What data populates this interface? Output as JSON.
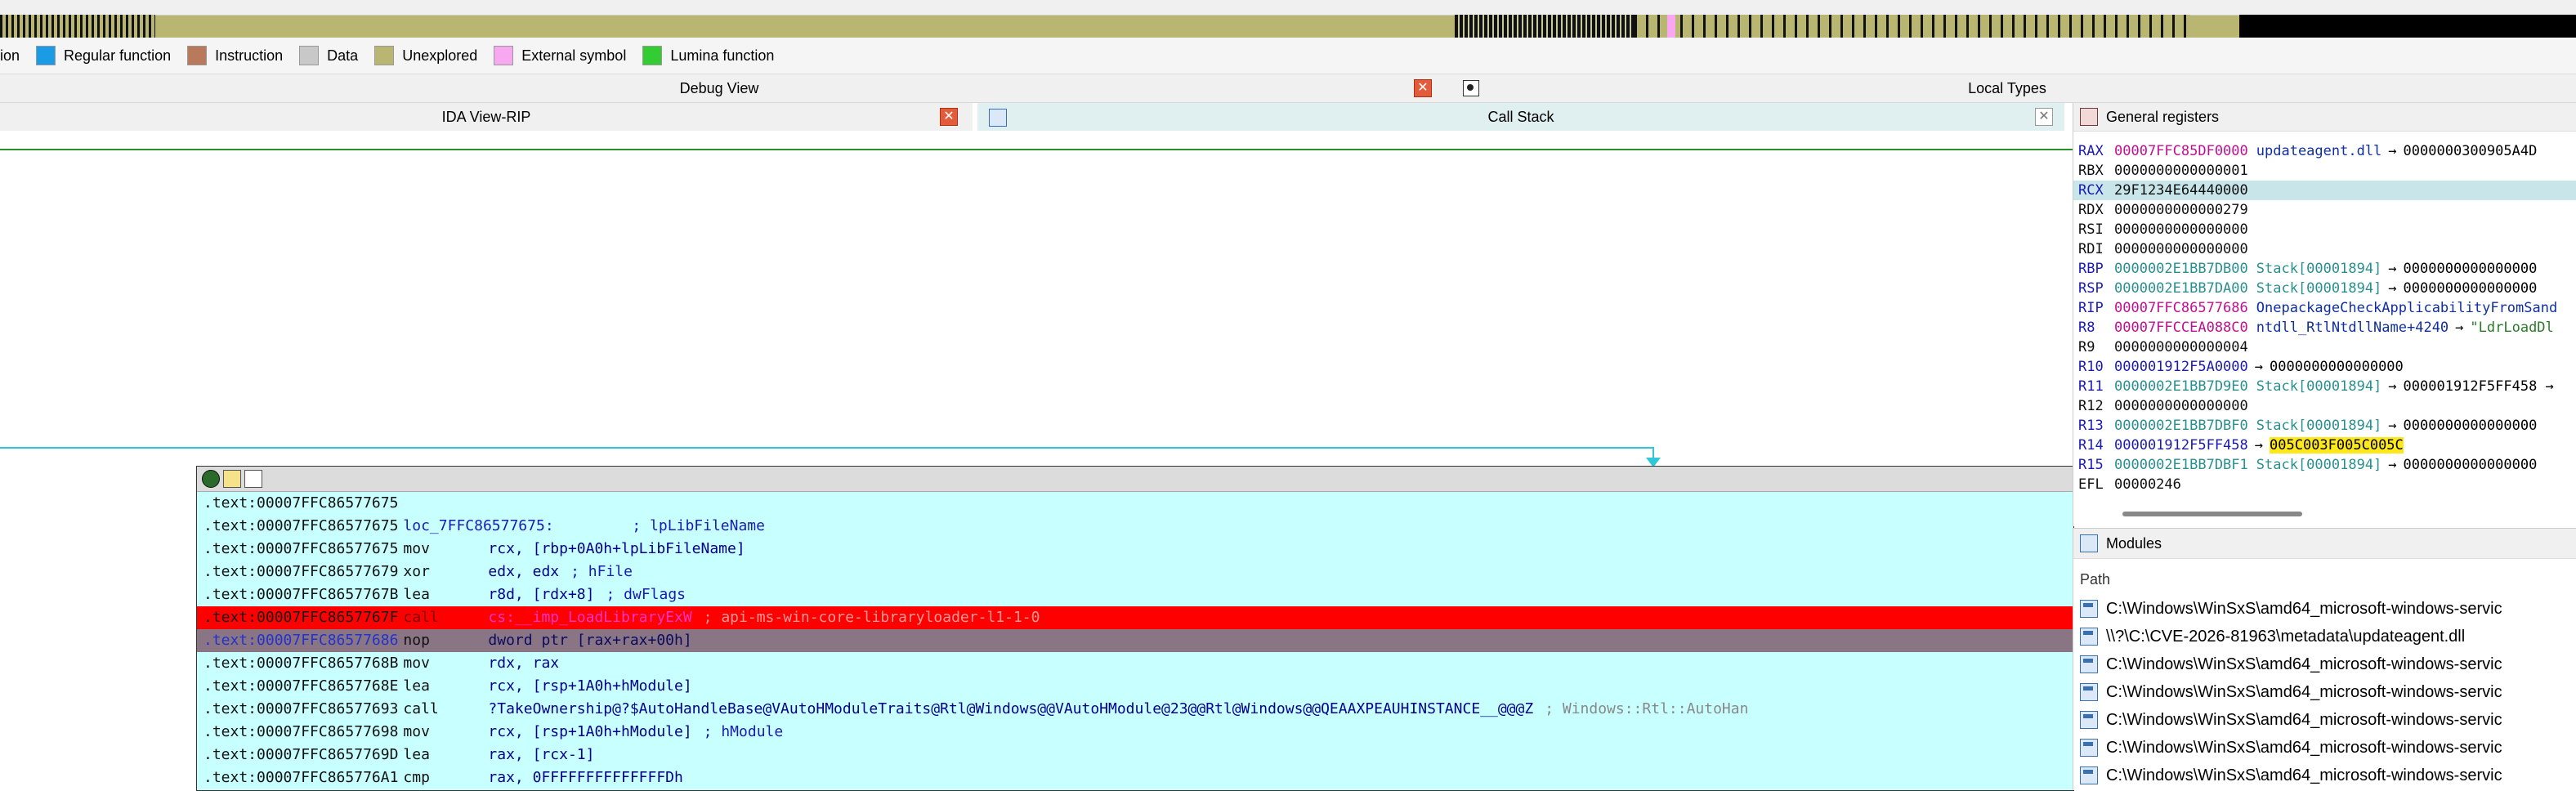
{
  "legend": [
    {
      "label": "ion",
      "color": ""
    },
    {
      "label": "Regular function",
      "color": "#1a9be6"
    },
    {
      "label": "Instruction",
      "color": "#b87a5a"
    },
    {
      "label": "Data",
      "color": "#c8c8c8"
    },
    {
      "label": "Unexplored",
      "color": "#b9b671"
    },
    {
      "label": "External symbol",
      "color": "#f7a8f0"
    },
    {
      "label": "Lumina function",
      "color": "#33cc33"
    }
  ],
  "debug_view": {
    "title": "Debug View"
  },
  "ida_view": {
    "title": "IDA View-RIP"
  },
  "call_stack": {
    "title": "Call Stack"
  },
  "local_types": {
    "title": "Local Types"
  },
  "registers": {
    "title": "General registers",
    "rows": [
      {
        "name": "RAX",
        "value": "00007FFC85DF0000",
        "ref": "updateagent.dll",
        "target": "0000000300905A4D",
        "arrow": "→",
        "highlight": false
      },
      {
        "name": "RBX",
        "value": "0000000000000001",
        "ref": "",
        "target": "",
        "arrow": "",
        "highlight": false
      },
      {
        "name": "RCX",
        "value": "29F1234E64440000",
        "ref": "",
        "target": "",
        "arrow": "",
        "highlight": true
      },
      {
        "name": "RDX",
        "value": "0000000000000279",
        "ref": "",
        "target": "",
        "arrow": "",
        "highlight": false
      },
      {
        "name": "RSI",
        "value": "0000000000000000",
        "ref": "",
        "target": "",
        "arrow": "",
        "highlight": false
      },
      {
        "name": "RDI",
        "value": "0000000000000000",
        "ref": "",
        "target": "",
        "arrow": "",
        "highlight": false
      },
      {
        "name": "RBP",
        "value": "0000002E1BB7DB00",
        "ref": "Stack[00001894]",
        "target": "0000000000000000",
        "arrow": "→",
        "highlight": false
      },
      {
        "name": "RSP",
        "value": "0000002E1BB7DA00",
        "ref": "Stack[00001894]",
        "target": "0000000000000000",
        "arrow": "→",
        "highlight": false
      },
      {
        "name": "RIP",
        "value": "00007FFC86577686",
        "ref": "OnepackageCheckApplicabilityFromSand",
        "target": "",
        "arrow": "",
        "highlight": false
      },
      {
        "name": "R8",
        "value": "00007FFCCEA088C0",
        "ref": "ntdll_RtlNtdllName+4240",
        "target": "\"LdrLoadDl",
        "arrow": "→",
        "highlight": false
      },
      {
        "name": "R9",
        "value": "0000000000000004",
        "ref": "",
        "target": "",
        "arrow": "",
        "highlight": false
      },
      {
        "name": "R10",
        "value": "000001912F5A0000",
        "ref": "",
        "target": "0000000000000000",
        "arrow": "→",
        "highlight": false
      },
      {
        "name": "R11",
        "value": "0000002E1BB7D9E0",
        "ref": "Stack[00001894]",
        "target": "000001912F5FF458 →",
        "arrow": "→",
        "highlight": false
      },
      {
        "name": "R12",
        "value": "0000000000000000",
        "ref": "",
        "target": "",
        "arrow": "",
        "highlight": false
      },
      {
        "name": "R13",
        "value": "0000002E1BB7DBF0",
        "ref": "Stack[00001894]",
        "target": "0000000000000000",
        "arrow": "→",
        "highlight": false
      },
      {
        "name": "R14",
        "value": "000001912F5FF458",
        "ref": "",
        "target": "005C003F005C005C",
        "arrow": "→",
        "highlight": false
      },
      {
        "name": "R15",
        "value": "0000002E1BB7DBF1",
        "ref": "Stack[00001894]",
        "target": "0000000000000000",
        "arrow": "→",
        "highlight": false
      },
      {
        "name": "EFL",
        "value": "00000246",
        "ref": "",
        "target": "",
        "arrow": "",
        "highlight": false
      }
    ]
  },
  "modules": {
    "title": "Modules",
    "column": "Path",
    "rows": [
      "C:\\Windows\\WinSxS\\amd64_microsoft-windows-servic",
      "\\\\?\\C:\\CVE-2026-81963\\metadata\\updateagent.dll",
      "C:\\Windows\\WinSxS\\amd64_microsoft-windows-servic",
      "C:\\Windows\\WinSxS\\amd64_microsoft-windows-servic",
      "C:\\Windows\\WinSxS\\amd64_microsoft-windows-servic",
      "C:\\Windows\\WinSxS\\amd64_microsoft-windows-servic",
      "C:\\Windows\\WinSxS\\amd64_microsoft-windows-servic"
    ]
  },
  "disasm": [
    {
      "addr": ".text:00007FFC86577675",
      "mnem": "",
      "ops": "",
      "comment": "",
      "style": "normal"
    },
    {
      "addr": ".text:00007FFC86577675",
      "mnem": "loc_7FFC86577675:",
      "ops": "",
      "comment": "; lpLibFileName",
      "style": "label"
    },
    {
      "addr": ".text:00007FFC86577675",
      "mnem": "mov",
      "ops": "rcx, [rbp+0A0h+lpLibFileName]",
      "comment": "",
      "style": "normal"
    },
    {
      "addr": ".text:00007FFC86577679",
      "mnem": "xor",
      "ops": "edx, edx",
      "comment": "; hFile",
      "style": "normal"
    },
    {
      "addr": ".text:00007FFC8657767B",
      "mnem": "lea",
      "ops": "r8d, [rdx+8]",
      "comment": "; dwFlags",
      "style": "normal"
    },
    {
      "addr": ".text:00007FFC8657767F",
      "mnem": "call",
      "ops": "cs:__imp_LoadLibraryExW",
      "comment": "; api-ms-win-core-libraryloader-l1-1-0",
      "style": "breakpoint"
    },
    {
      "addr": ".text:00007FFC86577686",
      "mnem": "nop",
      "ops": "dword ptr [rax+rax+00h]",
      "comment": "",
      "style": "current"
    },
    {
      "addr": ".text:00007FFC8657768B",
      "mnem": "mov",
      "ops": "rdx, rax",
      "comment": "",
      "style": "normal"
    },
    {
      "addr": ".text:00007FFC8657768E",
      "mnem": "lea",
      "ops": "rcx, [rsp+1A0h+hModule]",
      "comment": "",
      "style": "normal"
    },
    {
      "addr": ".text:00007FFC86577693",
      "mnem": "call",
      "ops": "?TakeOwnership@?$AutoHandleBase@VAutoHModuleTraits@Rtl@Windows@@VAutoHModule@23@@Rtl@Windows@@QEAAXPEAUHINSTANCE__@@@Z",
      "comment": "; Windows::Rtl::AutoHan",
      "style": "normal"
    },
    {
      "addr": ".text:00007FFC86577698",
      "mnem": "mov",
      "ops": "rcx, [rsp+1A0h+hModule]",
      "comment": "; hModule",
      "style": "normal"
    },
    {
      "addr": ".text:00007FFC8657769D",
      "mnem": "lea",
      "ops": "rax, [rcx-1]",
      "comment": "",
      "style": "normal"
    },
    {
      "addr": ".text:00007FFC865776A1",
      "mnem": "cmp",
      "ops": "rax, 0FFFFFFFFFFFFFFDh",
      "comment": "",
      "style": "normal"
    }
  ]
}
